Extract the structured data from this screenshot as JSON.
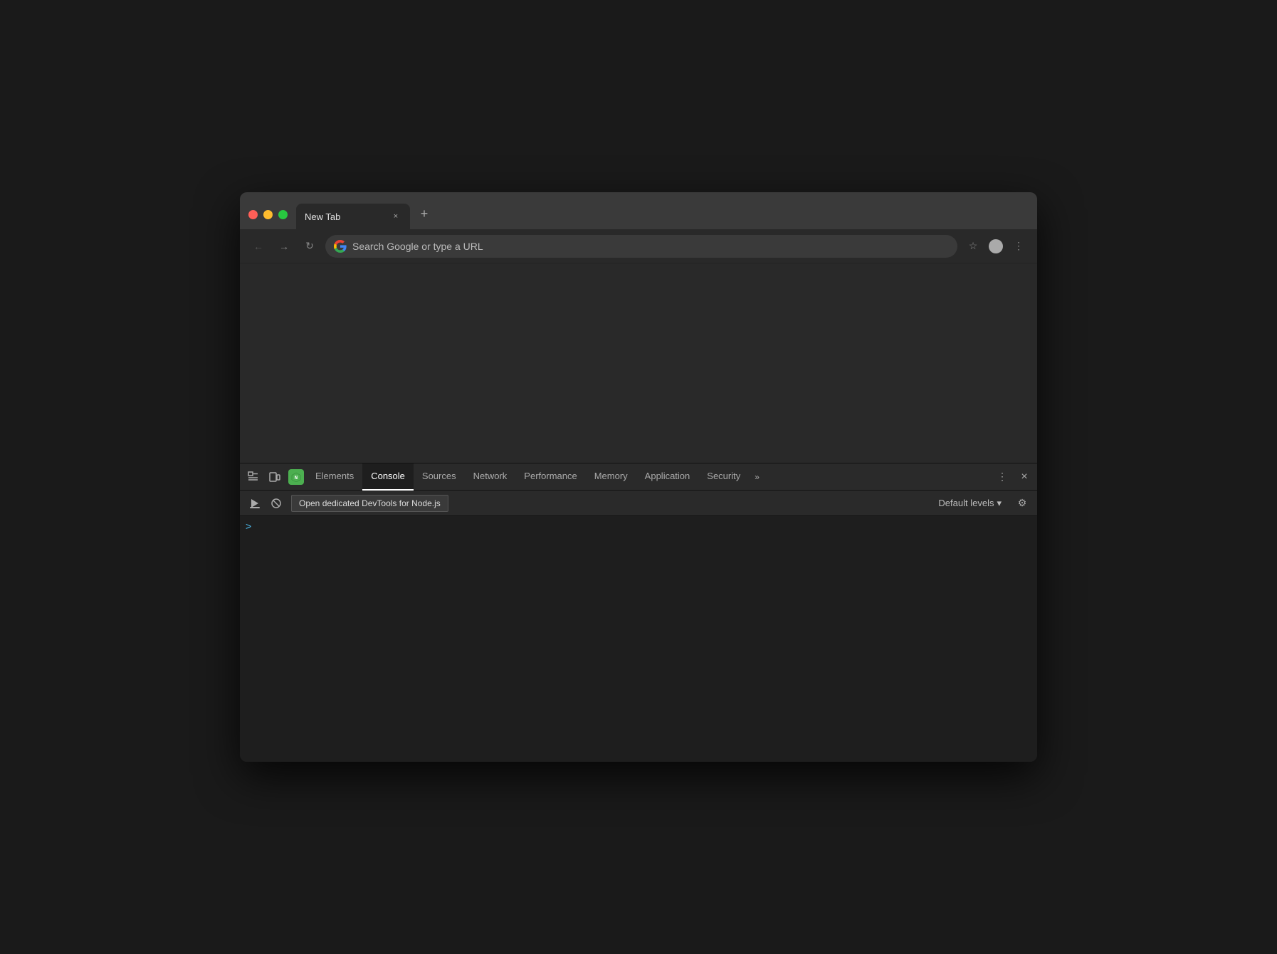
{
  "browser": {
    "tab": {
      "title": "New Tab",
      "close_label": "×"
    },
    "new_tab_label": "+",
    "nav": {
      "back_icon": "←",
      "forward_icon": "→",
      "reload_icon": "↻",
      "address_placeholder": "Search Google or type a URL",
      "bookmark_icon": "☆",
      "profile_icon": "○",
      "menu_icon": "⋮"
    }
  },
  "devtools": {
    "tabs": [
      {
        "id": "elements",
        "label": "Elements"
      },
      {
        "id": "console",
        "label": "Console"
      },
      {
        "id": "sources",
        "label": "Sources"
      },
      {
        "id": "network",
        "label": "Network"
      },
      {
        "id": "performance",
        "label": "Performance"
      },
      {
        "id": "memory",
        "label": "Memory"
      },
      {
        "id": "application",
        "label": "Application"
      },
      {
        "id": "security",
        "label": "Security"
      }
    ],
    "more_tabs_icon": "»",
    "active_tab": "console",
    "kebab_icon": "⋮",
    "close_icon": "×",
    "console": {
      "toolbar": {
        "clear_icon": "▷",
        "filter_icon": "🚫",
        "tooltip": "Open dedicated DevTools for Node.js",
        "levels_label": "Default levels",
        "levels_arrow": "▾",
        "settings_icon": "⚙"
      },
      "prompt_caret": ">"
    },
    "inspect_icon": "⬚",
    "device_icon": "□",
    "node_icon": "N"
  }
}
